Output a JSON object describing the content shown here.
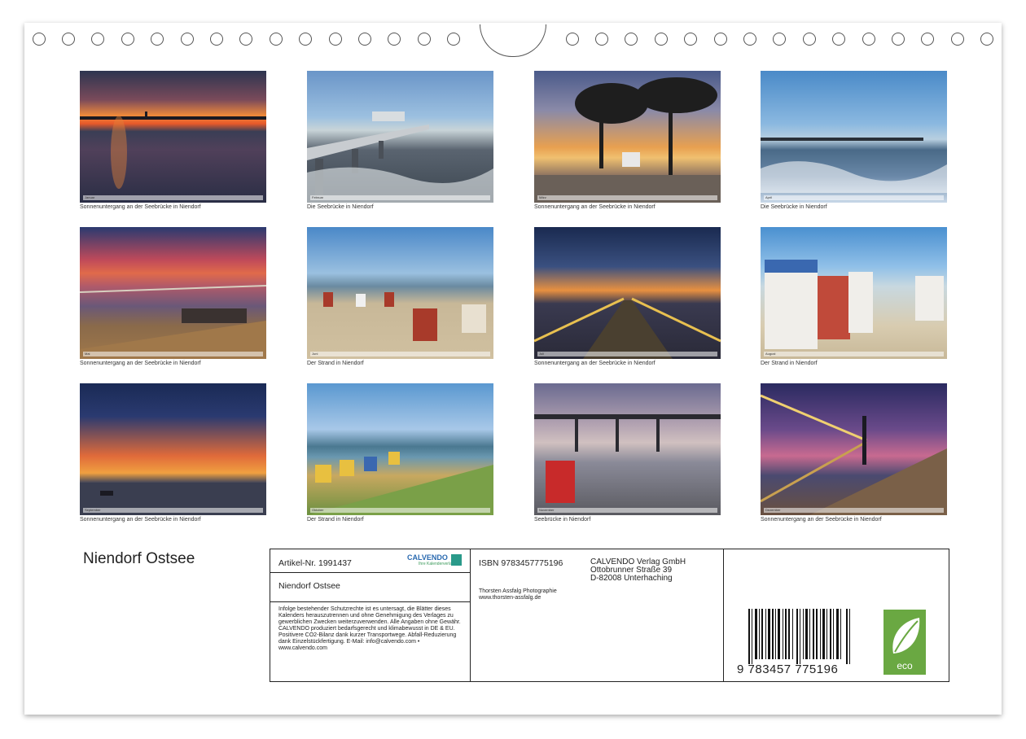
{
  "months": [
    {
      "label": "Januar",
      "caption": "Sonnenuntergang an der Seebrücke in Niendorf"
    },
    {
      "label": "Februar",
      "caption": "Die Seebrücke in Niendorf"
    },
    {
      "label": "März",
      "caption": "Sonnenuntergang an der Seebrücke in Niendorf"
    },
    {
      "label": "April",
      "caption": "Die Seebrücke in Niendorf"
    },
    {
      "label": "Mai",
      "caption": "Sonnenuntergang an der Seebrücke in Niendorf"
    },
    {
      "label": "Juni",
      "caption": "Der Strand in Niendorf"
    },
    {
      "label": "Juli",
      "caption": "Sonnenuntergang an der Seebrücke in Niendorf"
    },
    {
      "label": "August",
      "caption": "Der Strand in Niendorf"
    },
    {
      "label": "September",
      "caption": "Sonnenuntergang an der Seebrücke in Niendorf"
    },
    {
      "label": "Oktober",
      "caption": "Der Strand in Niendorf"
    },
    {
      "label": "November",
      "caption": "Seebrücke in Niendorf"
    },
    {
      "label": "Dezember",
      "caption": "Sonnenuntergang an der Seebrücke in Niendorf"
    }
  ],
  "title": "Niendorf Ostsee",
  "info": {
    "article": "Artikel-Nr. 1991437",
    "brand": "CALVENDO",
    "brand_sub": "Ihre Kalenderverlag",
    "title": "Niendorf Ostsee",
    "legal": "Infolge bestehender Schutzrechte ist es untersagt, die Blätter dieses Kalenders herauszutrennen und ohne Genehmigung des Verlages zu gewerblichen Zwecken weiterzuverwenden. Alle Angaben ohne Gewähr. CALVENDO produziert bedarfsgerecht und klimabewusst in DE & EU. Positivere CO2-Bilanz dank kurzer Transportwege. Abfall-Reduzierung dank Einzelstückfertigung. E-Mail: info@calvendo.com • www.calvendo.com",
    "isbn": "ISBN 9783457775196",
    "publisher_name": "CALVENDO Verlag GmbH",
    "publisher_street": "Ottobrunner Straße 39",
    "publisher_city": "D-82008 Unterhaching",
    "photographer": "Thorsten Assfalg Photographie",
    "photographer_url": "www.thorsten-assfalg.de",
    "barcode_digits": "9 783457 775196",
    "eco_label": "eco"
  },
  "colors": {
    "eco_green": "#6aa842"
  }
}
